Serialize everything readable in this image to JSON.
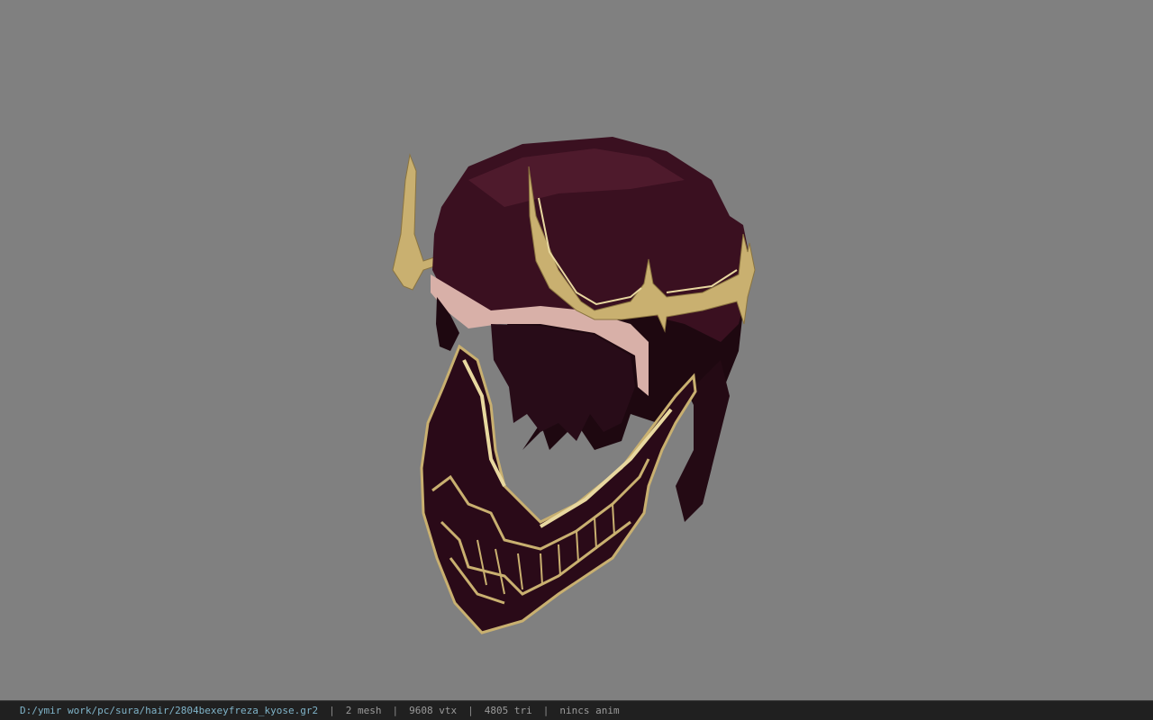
{
  "viewport": {
    "background": "#808080",
    "model_colors": {
      "hair_dark": "#1e0810",
      "hair_mid": "#3a1020",
      "hair_light": "#4e1a2c",
      "skin": "#d8b0a8",
      "gold": "#c9b070",
      "gold_dark": "#8a7440",
      "gold_light": "#e8d8a0",
      "mask_fill": "#2a0a18"
    }
  },
  "statusbar": {
    "file_path": "D:/ymir work/pc/sura/hair/2804bexeyfreza_kyose.gr2",
    "separator": "|",
    "mesh_count": "2 mesh",
    "vertex_count": "9608 vtx",
    "triangle_count": "4805 tri",
    "anim_status": "nincs anim"
  }
}
